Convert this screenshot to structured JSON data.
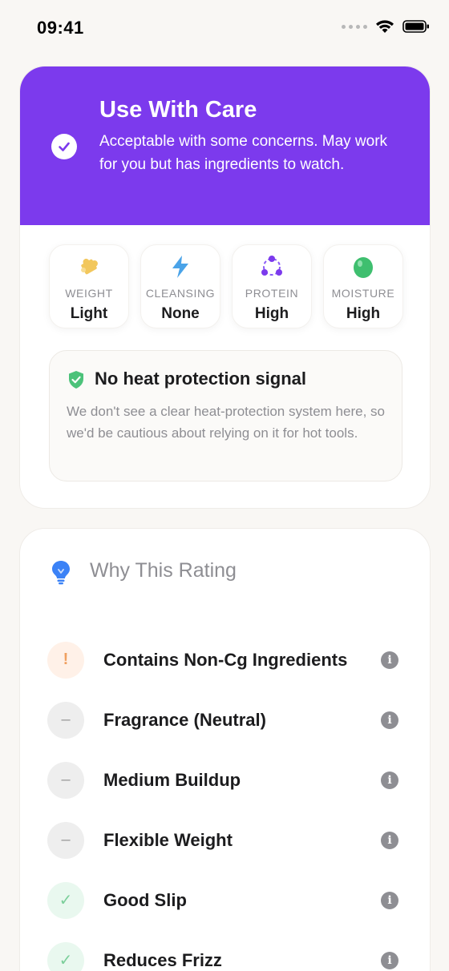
{
  "status_bar": {
    "time": "09:41"
  },
  "verdict": {
    "title": "Use With Care",
    "description": "Acceptable with some concerns. May work for you but has ingredients to watch.",
    "accent_color": "#7c3aed"
  },
  "metrics": [
    {
      "label": "WEIGHT",
      "value": "Light",
      "icon": "puzzle-icon"
    },
    {
      "label": "CLEANSING",
      "value": "None",
      "icon": "bolt-icon"
    },
    {
      "label": "PROTEIN",
      "value": "High",
      "icon": "molecule-icon"
    },
    {
      "label": "MOISTURE",
      "value": "High",
      "icon": "droplet-icon"
    }
  ],
  "heat": {
    "title": "No heat protection signal",
    "description": "We don't see a clear heat-protection system here, so we'd be cautious about relying on it for hot tools."
  },
  "why": {
    "title": "Why This Rating",
    "reasons": [
      {
        "label": "Contains Non-Cg Ingredients",
        "status": "warning",
        "symbol": "!"
      },
      {
        "label": "Fragrance (Neutral)",
        "status": "neutral",
        "symbol": "–"
      },
      {
        "label": "Medium Buildup",
        "status": "neutral",
        "symbol": "–"
      },
      {
        "label": "Flexible Weight",
        "status": "neutral",
        "symbol": "–"
      },
      {
        "label": "Good Slip",
        "status": "good",
        "symbol": "✓"
      },
      {
        "label": "Reduces Frizz",
        "status": "good",
        "symbol": "✓"
      }
    ],
    "info_symbol": "i"
  }
}
